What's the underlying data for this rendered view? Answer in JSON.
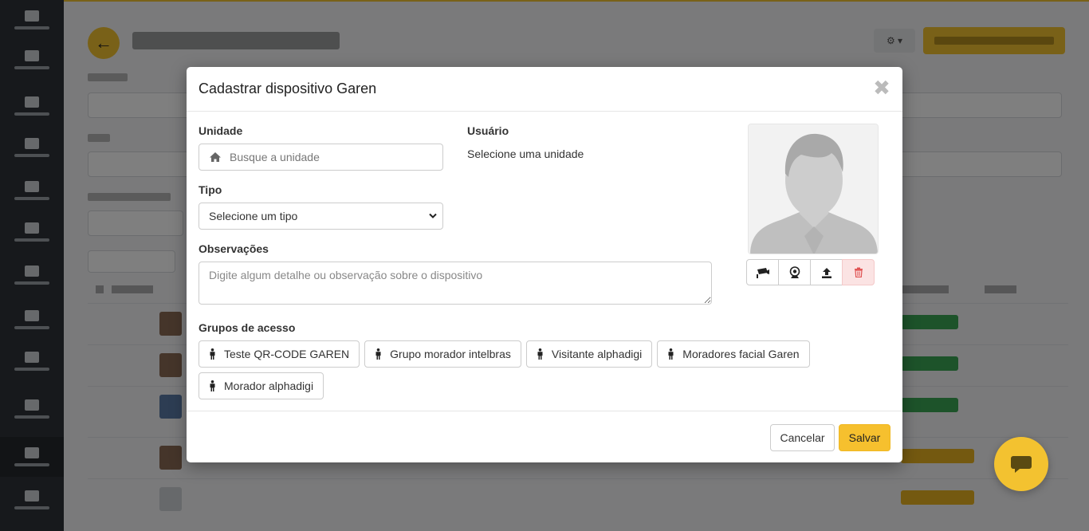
{
  "modal": {
    "title": "Cadastrar dispositivo Garen",
    "close_label": "✖",
    "unit": {
      "label": "Unidade",
      "placeholder": "Busque a unidade",
      "value": ""
    },
    "user": {
      "label": "Usuário",
      "value": "Selecione uma unidade"
    },
    "type": {
      "label": "Tipo",
      "selected": "Selecione um tipo",
      "options": [
        "Selecione um tipo"
      ]
    },
    "observations": {
      "label": "Observações",
      "placeholder": "Digite algum detalhe ou observação sobre o dispositivo",
      "value": ""
    },
    "photo_buttons": [
      {
        "icon": "camera-icon"
      },
      {
        "icon": "webcam-icon"
      },
      {
        "icon": "upload-icon"
      },
      {
        "icon": "trash-icon"
      }
    ],
    "groups": {
      "label": "Grupos de acesso",
      "items": [
        "Teste QR-CODE GAREN",
        "Grupo morador intelbras",
        "Visitante alphadigi",
        "Moradores facial Garen",
        "Morador alphadigi"
      ]
    },
    "footer": {
      "cancel_label": "Cancelar",
      "save_label": "Salvar"
    }
  },
  "colors": {
    "accent": "#f6c02e",
    "danger_bg": "#fbe3e3",
    "danger_icon": "#e05252",
    "overlay": "rgba(0,0,0,0.5)"
  }
}
